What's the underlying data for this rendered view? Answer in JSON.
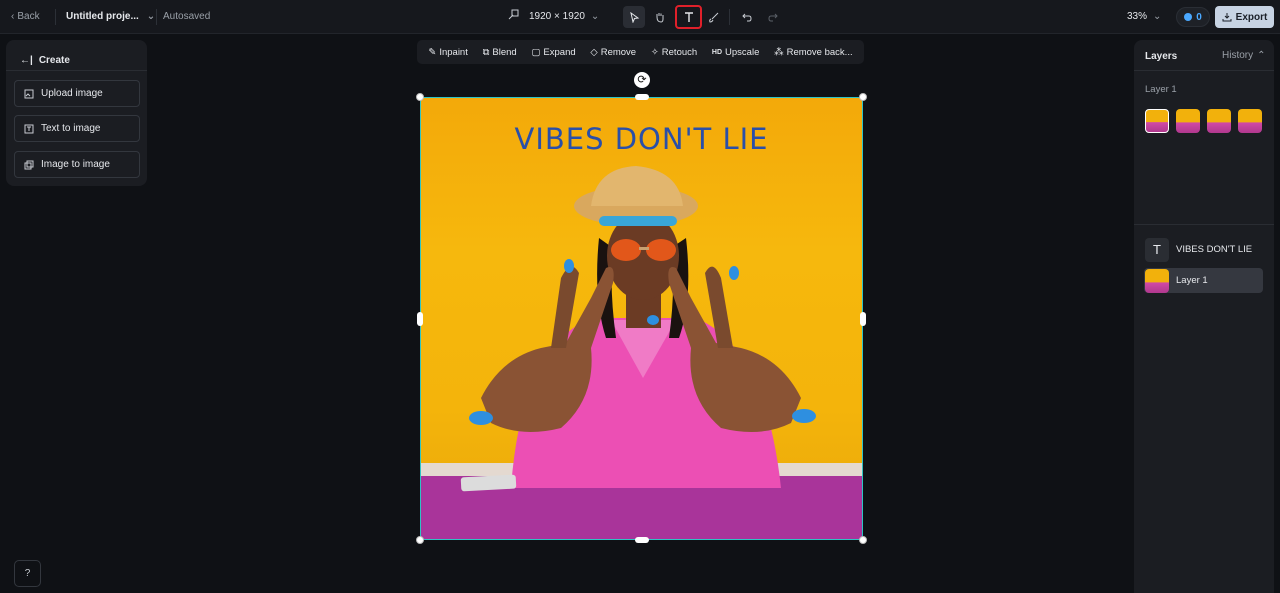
{
  "topbar": {
    "back_label": "Back",
    "project_name": "Untitled proje...",
    "autosaved_label": "Autosaved",
    "canvas_size": "1920 × 1920",
    "zoom": "33%",
    "credits": "0",
    "export_label": "Export"
  },
  "tools": [
    "select-tool",
    "hand-tool",
    "text-tool",
    "brush-tool",
    "undo",
    "redo"
  ],
  "create_panel": {
    "title": "Create",
    "buttons": [
      "Upload image",
      "Text to image",
      "Image to image"
    ]
  },
  "edit_toolbar": {
    "items": [
      "Inpaint",
      "Blend",
      "Expand",
      "Remove",
      "Retouch",
      "Upscale",
      "Remove back..."
    ],
    "upscale_badge": "HD"
  },
  "canvas": {
    "overlay_text": "VIBES DON'T LIE"
  },
  "layers_panel": {
    "title": "Layers",
    "history_label": "History",
    "group_label": "Layer 1",
    "layers": [
      {
        "name": "VIBES DON'T LIE",
        "kind": "text"
      },
      {
        "name": "Layer 1",
        "kind": "image"
      }
    ]
  },
  "colors": {
    "accent_selection": "#2ec4c4",
    "highlight": "#e0202a",
    "credits": "#4aa8ff",
    "text_overlay": "#2a4fa8"
  }
}
